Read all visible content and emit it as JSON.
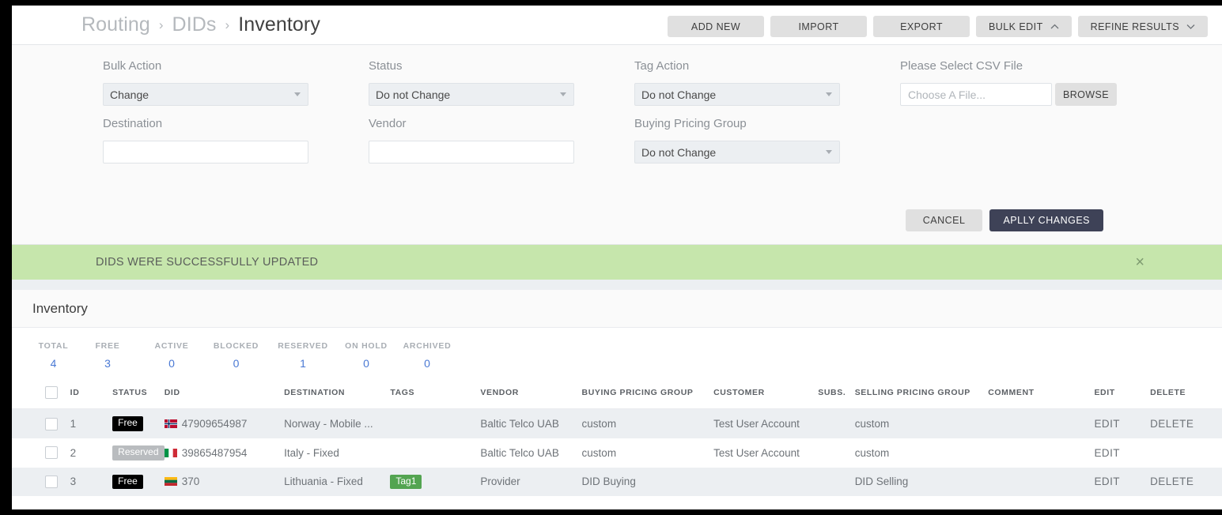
{
  "breadcrumb": {
    "items": [
      {
        "label": "Routing",
        "current": false
      },
      {
        "label": "DIDs",
        "current": false
      },
      {
        "label": "Inventory",
        "current": true
      }
    ],
    "separator": "›"
  },
  "toolbar": {
    "add_new": "ADD NEW",
    "import": "IMPORT",
    "export": "EXPORT",
    "bulk_edit": "BULK EDIT",
    "refine_results": "REFINE RESULTS"
  },
  "bulk_panel": {
    "bulk_action": {
      "label": "Bulk Action",
      "value": "Change"
    },
    "status": {
      "label": "Status",
      "value": "Do not Change"
    },
    "tag_action": {
      "label": "Tag Action",
      "value": "Do not Change"
    },
    "csv": {
      "label": "Please Select CSV File",
      "value": "",
      "placeholder": "Choose A File...",
      "browse": "BROWSE"
    },
    "destination": {
      "label": "Destination",
      "value": ""
    },
    "vendor": {
      "label": "Vendor",
      "value": ""
    },
    "buying_pricing_group": {
      "label": "Buying Pricing Group",
      "value": "Do not Change"
    },
    "cancel": "CANCEL",
    "apply": "APLLY CHANGES"
  },
  "alert": {
    "message": "DIDS WERE SUCCESSFULLY UPDATED",
    "close": "×",
    "bg_color": "#c6e6ac"
  },
  "inventory": {
    "title": "Inventory",
    "stats": [
      {
        "label": "TOTAL",
        "value": "4"
      },
      {
        "label": "FREE",
        "value": "3"
      },
      {
        "label": "ACTIVE",
        "value": "0"
      },
      {
        "label": "BLOCKED",
        "value": "0"
      },
      {
        "label": "RESERVED",
        "value": "1"
      },
      {
        "label": "ON HOLD",
        "value": "0"
      },
      {
        "label": "ARCHIVED",
        "value": "0"
      }
    ],
    "columns": [
      "",
      "ID",
      "STATUS",
      "DID",
      "DESTINATION",
      "TAGS",
      "VENDOR",
      "BUYING PRICING GROUP",
      "CUSTOMER",
      "SUBS.",
      "SELLING PRICING GROUP",
      "COMMENT",
      "EDIT",
      "DELETE"
    ],
    "rows": [
      {
        "id": "1",
        "status": "Free",
        "status_kind": "free",
        "flag": "norway-flag",
        "did": "47909654987",
        "destination": "Norway - Mobile ...",
        "tags": "",
        "vendor": "Baltic Telco UAB",
        "buying_pricing_group": "custom",
        "customer": "Test User Account",
        "subs": "",
        "selling_pricing_group": "custom",
        "comment": "",
        "edit": "EDIT",
        "delete": "DELETE"
      },
      {
        "id": "2",
        "status": "Reserved",
        "status_kind": "reserved",
        "flag": "italy-flag",
        "did": "39865487954",
        "destination": "Italy - Fixed",
        "tags": "",
        "vendor": "Baltic Telco UAB",
        "buying_pricing_group": "custom",
        "customer": "Test User Account",
        "subs": "",
        "selling_pricing_group": "custom",
        "comment": "",
        "edit": "EDIT",
        "delete": ""
      },
      {
        "id": "3",
        "status": "Free",
        "status_kind": "free",
        "flag": "lithuania-flag",
        "did": "370",
        "destination": "Lithuania - Fixed",
        "tags": "Tag1",
        "vendor": "Provider",
        "buying_pricing_group": "DID Buying",
        "customer": "",
        "subs": "",
        "selling_pricing_group": "DID Selling",
        "comment": "",
        "edit": "EDIT",
        "delete": "DELETE"
      }
    ]
  },
  "colors": {
    "accent": "#4a79d4",
    "apply_button": "#3e4257",
    "tag": "#53a451",
    "badge_free": "#000000",
    "badge_reserved": "#b9bcbf"
  }
}
